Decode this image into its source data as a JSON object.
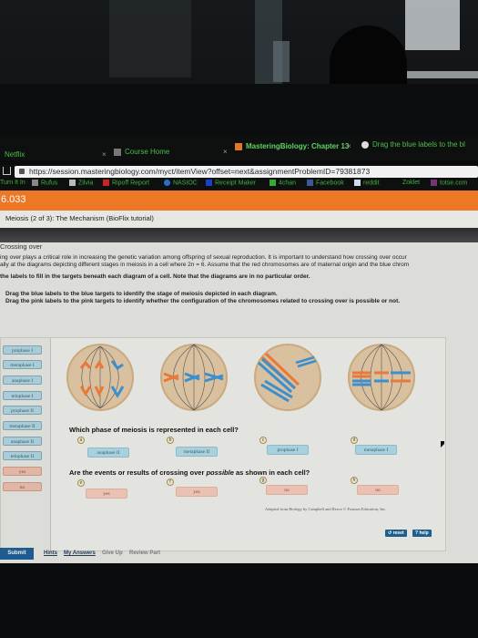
{
  "browser": {
    "tabs": [
      {
        "label": "Netflix"
      },
      {
        "label": "Course Home"
      },
      {
        "label": "MasteringBiology: Chapter 13"
      },
      {
        "label": "Drag the blue labels to the bl"
      }
    ],
    "close_glyph": "×",
    "url": "https://session.masteringbiology.com/myct/itemView?offset=next&assignmentProblemID=79381873",
    "bookmarks": [
      "Turn It In",
      "Rufus",
      "Zilvia",
      "Ripoff Report",
      "NASIOC",
      "Receipt Maker",
      "4chan",
      "Facebook",
      "reddit",
      "Zoklet",
      "totse.com"
    ]
  },
  "header": {
    "number": "6.033",
    "title": "Meiosis (2 of 3): The Mechanism (BioFlix tutorial)"
  },
  "intro": {
    "section": "Crossing over",
    "line1": "ing over plays a critical role in increasing the genetic variation among offspring of sexual reproduction. It is important to understand how crossing over occur",
    "line2": "ally at the diagrams depicting different stages in meiosis in a cell where 2n = 6. Assume that the red chromosomes are of maternal origin and the blue chrom",
    "line3": "the labels to fill in the targets beneath each diagram of a cell. Note that the diagrams are in no particular order.",
    "instruction1": "Drag the blue labels to the blue targets to identify the stage of meiosis depicted in each diagram.",
    "instruction2": "Drag the pink labels to the pink targets to identify whether the configuration of the chromosomes related to crossing over is possible or not."
  },
  "label_bank": {
    "blue": [
      "prophase I",
      "metaphase I",
      "anaphase I",
      "telophase I",
      "prophase II",
      "metaphase II",
      "anaphase II",
      "telophase II"
    ],
    "pink": [
      "yes",
      "no"
    ]
  },
  "questions": {
    "q1": "Which phase of meiosis is represented in each cell?",
    "q2_pre": "Are the events or results of crossing over ",
    "q2_em": "possible",
    "q2_post": " as shown in each cell?"
  },
  "targets": {
    "phase": [
      {
        "letter": "a",
        "value": "anaphase II"
      },
      {
        "letter": "b",
        "value": "metaphase II"
      },
      {
        "letter": "c",
        "value": "prophase I"
      },
      {
        "letter": "d",
        "value": "metaphase I"
      }
    ],
    "crossing": [
      {
        "letter": "e",
        "value": "yes"
      },
      {
        "letter": "f",
        "value": "yes"
      },
      {
        "letter": "g",
        "value": "no"
      },
      {
        "letter": "h",
        "value": "no"
      }
    ]
  },
  "credit": "Adapted from Biology by Campbell and Reece © Pearson Education, Inc.",
  "controls": {
    "reset": "↺ reset",
    "help": "? help"
  },
  "footer": {
    "submit": "Submit",
    "links": [
      "Hints",
      "My Answers",
      "Give Up",
      "Review Part"
    ]
  },
  "colors": {
    "brand_orange": "#ec7826",
    "blue_label": "#a9cdd8",
    "pink_label": "#e2b6a6",
    "submit_blue": "#1e5b8e",
    "maternal": "#e8793a",
    "paternal": "#3a8fd0"
  }
}
